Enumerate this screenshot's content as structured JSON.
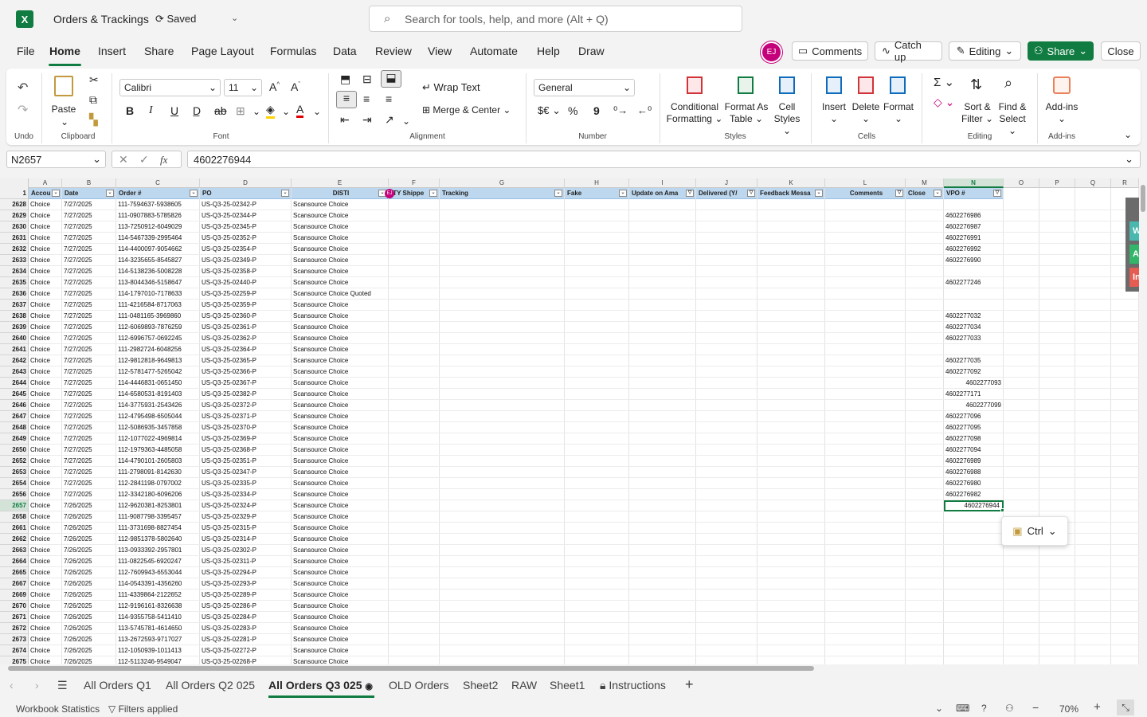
{
  "title_bar": {
    "logo_letter": "X",
    "doc_title": "Orders & Trackings",
    "saved": "Saved",
    "search_placeholder": "Search for tools, help, and more (Alt + Q)"
  },
  "menu": [
    "File",
    "Home",
    "Insert",
    "Share",
    "Page Layout",
    "Formulas",
    "Data",
    "Review",
    "View",
    "Automate",
    "Help",
    "Draw"
  ],
  "user_initials": "EJ",
  "top_buttons": {
    "comments": "Comments",
    "catch_up": "Catch up",
    "editing": "Editing",
    "share": "Share",
    "close": "Close"
  },
  "ribbon": {
    "undo_label": "Undo",
    "clipboard": {
      "paste": "Paste",
      "label": "Clipboard"
    },
    "font": {
      "name": "Calibri",
      "size": "11",
      "label": "Font",
      "bold": "B",
      "italic": "I",
      "underline": "U"
    },
    "alignment": {
      "wrap": "Wrap Text",
      "merge": "Merge & Center",
      "label": "Alignment"
    },
    "number": {
      "format": "General",
      "currency": "$€",
      "percent": "%",
      "comma": "9",
      "label": "Number"
    },
    "styles": {
      "conditional_1": "Conditional",
      "conditional_2": "Formatting",
      "format_table_1": "Format As",
      "format_table_2": "Table",
      "cell_styles_1": "Cell",
      "cell_styles_2": "Styles",
      "label": "Styles"
    },
    "cells": {
      "insert": "Insert",
      "delete": "Delete",
      "format": "Format",
      "label": "Cells"
    },
    "editing": {
      "sort_1": "Sort &",
      "sort_2": "Filter",
      "find_1": "Find &",
      "find_2": "Select",
      "label": "Editing"
    },
    "addins": {
      "addins": "Add-ins",
      "label": "Add-ins"
    }
  },
  "formula_bar": {
    "name_box": "N2657",
    "fx": "fx",
    "value": "4602276944"
  },
  "columns": [
    "A",
    "B",
    "C",
    "D",
    "E",
    "F",
    "G",
    "H",
    "I",
    "J",
    "K",
    "L",
    "M",
    "N",
    "O",
    "P",
    "Q",
    "R"
  ],
  "headers": [
    "Accou",
    "Date",
    "Order #",
    "PO",
    "DISTI",
    "ITY Shippe",
    "Tracking",
    "Fake",
    "Update on Ama",
    "Delivered (Y/",
    "Feedback Messa",
    "Comments",
    "Close",
    "VPO #"
  ],
  "rows": [
    {
      "r": "2628",
      "date": "7/27/2025",
      "order": "111-7594637-5938605",
      "po": "US-Q3-25-02342-P",
      "disti": "Scansource Choice",
      "vpo": ""
    },
    {
      "r": "2629",
      "date": "7/27/2025",
      "order": "111-0907883-5785826",
      "po": "US-Q3-25-02344-P",
      "disti": "Scansource Choice",
      "vpo": "4602276986"
    },
    {
      "r": "2630",
      "date": "7/27/2025",
      "order": "113-7250912-6049029",
      "po": "US-Q3-25-02345-P",
      "disti": "Scansource Choice",
      "vpo": "4602276987"
    },
    {
      "r": "2631",
      "date": "7/27/2025",
      "order": "114-5467339-2995464",
      "po": "US-Q3-25-02352-P",
      "disti": "Scansource Choice",
      "vpo": "4602276991"
    },
    {
      "r": "2632",
      "date": "7/27/2025",
      "order": "114-4400097-9054662",
      "po": "US-Q3-25-02354-P",
      "disti": "Scansource Choice",
      "vpo": "4602276992"
    },
    {
      "r": "2633",
      "date": "7/27/2025",
      "order": "114-3235655-8545827",
      "po": "US-Q3-25-02349-P",
      "disti": "Scansource Choice",
      "vpo": "4602276990"
    },
    {
      "r": "2634",
      "date": "7/27/2025",
      "order": "114-5138236-5008228",
      "po": "US-Q3-25-02358-P",
      "disti": "Scansource Choice",
      "vpo": ""
    },
    {
      "r": "2635",
      "date": "7/27/2025",
      "order": "113-8044346-5158647",
      "po": "US-Q3-25-02440-P",
      "disti": "Scansource Choice",
      "vpo": "4602277246"
    },
    {
      "r": "2636",
      "date": "7/27/2025",
      "order": "114-1797010-7178633",
      "po": "US-Q3-25-02259-P",
      "disti": "Scansource Choice Quoted",
      "vpo": ""
    },
    {
      "r": "2637",
      "date": "7/27/2025",
      "order": "111-4216584-8717063",
      "po": "US-Q3-25-02359-P",
      "disti": "Scansource Choice",
      "vpo": ""
    },
    {
      "r": "2638",
      "date": "7/27/2025",
      "order": "111-0481165-3969860",
      "po": "US-Q3-25-02360-P",
      "disti": "Scansource Choice",
      "vpo": "4602277032"
    },
    {
      "r": "2639",
      "date": "7/27/2025",
      "order": "112-6069893-7876259",
      "po": "US-Q3-25-02361-P",
      "disti": "Scansource Choice",
      "vpo": "4602277034"
    },
    {
      "r": "2640",
      "date": "7/27/2025",
      "order": "112-6996757-0692245",
      "po": "US-Q3-25-02362-P",
      "disti": "Scansource Choice",
      "vpo": "4602277033"
    },
    {
      "r": "2641",
      "date": "7/27/2025",
      "order": "111-2982724-6048256",
      "po": "US-Q3-25-02364-P",
      "disti": "Scansource Choice",
      "vpo": ""
    },
    {
      "r": "2642",
      "date": "7/27/2025",
      "order": "112-9812818-9649813",
      "po": "US-Q3-25-02365-P",
      "disti": "Scansource Choice",
      "vpo": "4602277035"
    },
    {
      "r": "2643",
      "date": "7/27/2025",
      "order": "112-5781477-5265042",
      "po": "US-Q3-25-02366-P",
      "disti": "Scansource Choice",
      "vpo": "4602277092"
    },
    {
      "r": "2644",
      "date": "7/27/2025",
      "order": "114-4446831-0651450",
      "po": "US-Q3-25-02367-P",
      "disti": "Scansource Choice",
      "vpo": "4602277093",
      "indent": true
    },
    {
      "r": "2645",
      "date": "7/27/2025",
      "order": "114-6580531-8191403",
      "po": "US-Q3-25-02382-P",
      "disti": "Scansource Choice",
      "vpo": "4602277171"
    },
    {
      "r": "2646",
      "date": "7/27/2025",
      "order": "114-3775931-2543426",
      "po": "US-Q3-25-02372-P",
      "disti": "Scansource Choice",
      "vpo": "4602277099",
      "indent": true
    },
    {
      "r": "2647",
      "date": "7/27/2025",
      "order": "112-4795498-6505044",
      "po": "US-Q3-25-02371-P",
      "disti": "Scansource Choice",
      "vpo": "4602277096"
    },
    {
      "r": "2648",
      "date": "7/27/2025",
      "order": "112-5086935-3457858",
      "po": "US-Q3-25-02370-P",
      "disti": "Scansource Choice",
      "vpo": "4602277095"
    },
    {
      "r": "2649",
      "date": "7/27/2025",
      "order": "112-1077022-4969814",
      "po": "US-Q3-25-02369-P",
      "disti": "Scansource Choice",
      "vpo": "4602277098"
    },
    {
      "r": "2650",
      "date": "7/27/2025",
      "order": "112-1979363-4485058",
      "po": "US-Q3-25-02368-P",
      "disti": "Scansource Choice",
      "vpo": "4602277094"
    },
    {
      "r": "2652",
      "date": "7/27/2025",
      "order": "114-4790101-2605803",
      "po": "US-Q3-25-02351-P",
      "disti": "Scansource Choice",
      "vpo": "4602276989"
    },
    {
      "r": "2653",
      "date": "7/27/2025",
      "order": "111-2798091-8142630",
      "po": "US-Q3-25-02347-P",
      "disti": "Scansource Choice",
      "vpo": "4602276988"
    },
    {
      "r": "2654",
      "date": "7/27/2025",
      "order": "112-2841198-0797002",
      "po": "US-Q3-25-02335-P",
      "disti": "Scansource Choice",
      "vpo": "4602276980"
    },
    {
      "r": "2656",
      "date": "7/27/2025",
      "order": "112-3342180-6096206",
      "po": "US-Q3-25-02334-P",
      "disti": "Scansource Choice",
      "vpo": "4602276982"
    },
    {
      "r": "2657",
      "date": "7/26/2025",
      "order": "112-9620381-8253801",
      "po": "US-Q3-25-02324-P",
      "disti": "Scansource Choice",
      "vpo": "4602276944",
      "indent": true,
      "selected": true
    },
    {
      "r": "2658",
      "date": "7/26/2025",
      "order": "111-9087798-3395457",
      "po": "US-Q3-25-02329-P",
      "disti": "Scansource Choice",
      "vpo": ""
    },
    {
      "r": "2661",
      "date": "7/26/2025",
      "order": "111-3731698-8827454",
      "po": "US-Q3-25-02315-P",
      "disti": "Scansource Choice",
      "vpo": ""
    },
    {
      "r": "2662",
      "date": "7/26/2025",
      "order": "112-9851378-5802640",
      "po": "US-Q3-25-02314-P",
      "disti": "Scansource Choice",
      "vpo": ""
    },
    {
      "r": "2663",
      "date": "7/26/2025",
      "order": "113-0933392-2957801",
      "po": "US-Q3-25-02302-P",
      "disti": "Scansource Choice",
      "vpo": ""
    },
    {
      "r": "2664",
      "date": "7/26/2025",
      "order": "111-0822545-6920247",
      "po": "US-Q3-25-02311-P",
      "disti": "Scansource Choice",
      "vpo": ""
    },
    {
      "r": "2665",
      "date": "7/26/2025",
      "order": "112-7609943-6553044",
      "po": "US-Q3-25-02294-P",
      "disti": "Scansource Choice",
      "vpo": ""
    },
    {
      "r": "2667",
      "date": "7/26/2025",
      "order": "114-0543391-4356260",
      "po": "US-Q3-25-02293-P",
      "disti": "Scansource Choice",
      "vpo": ""
    },
    {
      "r": "2669",
      "date": "7/26/2025",
      "order": "111-4339864-2122652",
      "po": "US-Q3-25-02289-P",
      "disti": "Scansource Choice",
      "vpo": ""
    },
    {
      "r": "2670",
      "date": "7/26/2025",
      "order": "112-9196161-8326638",
      "po": "US-Q3-25-02286-P",
      "disti": "Scansource Choice",
      "vpo": ""
    },
    {
      "r": "2671",
      "date": "7/26/2025",
      "order": "114-9355758-5411410",
      "po": "US-Q3-25-02284-P",
      "disti": "Scansource Choice",
      "vpo": ""
    },
    {
      "r": "2672",
      "date": "7/26/2025",
      "order": "113-5745781-4614650",
      "po": "US-Q3-25-02283-P",
      "disti": "Scansource Choice",
      "vpo": ""
    },
    {
      "r": "2673",
      "date": "7/26/2025",
      "order": "113-2672593-9717027",
      "po": "US-Q3-25-02281-P",
      "disti": "Scansource Choice",
      "vpo": ""
    },
    {
      "r": "2674",
      "date": "7/26/2025",
      "order": "112-1050939-1011413",
      "po": "US-Q3-25-02272-P",
      "disti": "Scansource Choice",
      "vpo": ""
    },
    {
      "r": "2675",
      "date": "7/26/2025",
      "order": "112-5113246-9549047",
      "po": "US-Q3-25-02268-P",
      "disti": "Scansource Choice",
      "vpo": ""
    }
  ],
  "account_value": "Choice",
  "side_panel": [
    "W",
    "Ac",
    "In"
  ],
  "ctrl_popup": "Ctrl",
  "sheets": [
    "All Orders Q1",
    "All Orders Q2 025",
    "All Orders Q3 025",
    "OLD Orders",
    "Sheet2",
    "RAW",
    "Sheet1",
    "Instructions"
  ],
  "active_sheet_index": 2,
  "status": {
    "workbook_stats": "Workbook Statistics",
    "filters": "Filters applied",
    "zoom": "70%"
  },
  "colors": {
    "accent": "#107c41",
    "table_header": "#bdd7ee",
    "avatar": "#c4007a"
  }
}
